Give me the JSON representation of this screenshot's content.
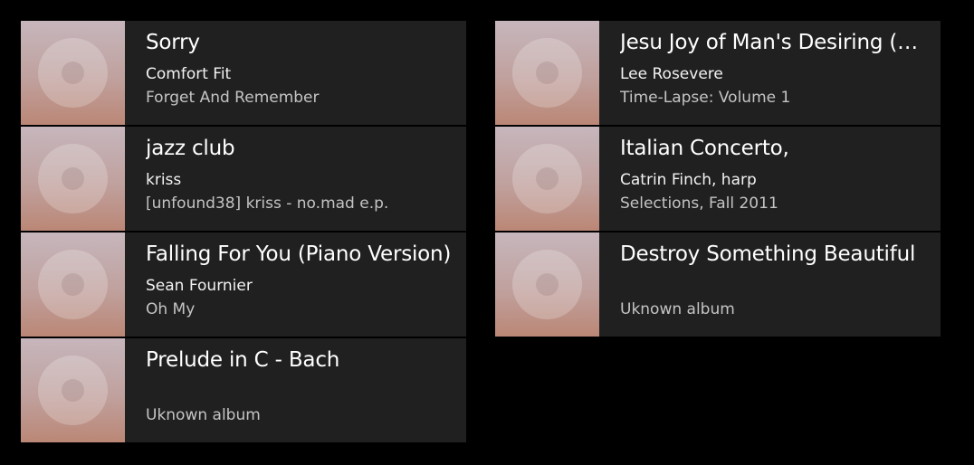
{
  "tracks_left": [
    {
      "title": "Sorry",
      "artist": "Comfort Fit",
      "album": "Forget And Remember",
      "art_icon": "album-disc-icon"
    },
    {
      "title": "jazz club",
      "artist": "kriss",
      "album": "[unfound38] kriss - no.mad e.p.",
      "art_icon": "album-disc-icon"
    },
    {
      "title": "Falling For You (Piano Version)",
      "artist": "Sean Fournier",
      "album": "Oh My",
      "art_icon": "album-disc-icon"
    },
    {
      "title": "Prelude in C - Bach",
      "artist": "",
      "album": "Uknown album",
      "art_icon": "album-disc-icon"
    }
  ],
  "tracks_right": [
    {
      "title": "Jesu Joy of Man's Desiring (Ba...",
      "artist": "Lee Rosevere",
      "album": "Time-Lapse: Volume 1",
      "art_icon": "album-disc-icon"
    },
    {
      "title": "Italian Concerto,",
      "artist": "Catrin Finch, harp",
      "album": "Selections, Fall 2011",
      "art_icon": "album-disc-icon"
    },
    {
      "title": "Destroy Something Beautiful",
      "artist": "",
      "album": "Uknown album",
      "art_icon": "album-disc-icon"
    }
  ],
  "colors": {
    "background": "#000000",
    "card": "#202020",
    "title_text": "#ffffff",
    "secondary_text": "#c4c4c4",
    "art_gradient_top": "#c6b6bc",
    "art_gradient_bottom": "#bb8776"
  }
}
